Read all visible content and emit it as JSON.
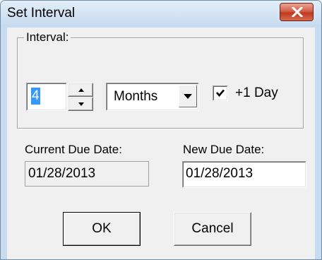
{
  "window": {
    "title": "Set Interval"
  },
  "interval_group": {
    "label": "Interval:",
    "value": "4",
    "units": "Months",
    "plus_one_day": {
      "checked": true,
      "label": "+1 Day"
    }
  },
  "current_due": {
    "label": "Current Due Date:",
    "value": "01/28/2013"
  },
  "new_due": {
    "label": "New Due Date:",
    "value": "01/28/2013"
  },
  "buttons": {
    "ok": "OK",
    "cancel": "Cancel"
  },
  "icons": {
    "close": "close-icon",
    "spin_up": "arrow-up-icon",
    "spin_down": "arrow-down-icon",
    "dropdown": "chevron-down-icon",
    "check": "checkmark-icon"
  },
  "colors": {
    "titlebar": "#c9dcef",
    "close_button": "#c74a30",
    "selection": "#3399ff",
    "dialog_bg": "#f0f0f0"
  }
}
